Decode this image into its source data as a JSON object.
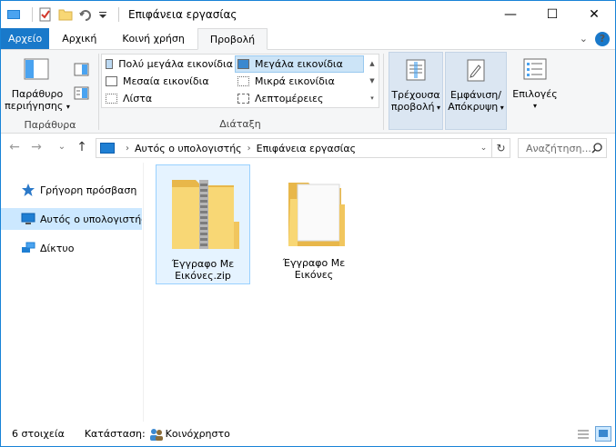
{
  "window": {
    "title": "Επιφάνεια εργασίας",
    "controls": {
      "minimize": "—",
      "maximize": "☐",
      "close": "✕"
    }
  },
  "ribbon_tabs": [
    "Αρχείο",
    "Αρχική",
    "Κοινή χρήση",
    "Προβολή"
  ],
  "ribbon_tabs_active": "Προβολή",
  "ribbon": {
    "panes": {
      "nav_pane_label_1": "Παράθυρο",
      "nav_pane_label_2": "περιήγησης",
      "group_label": "Παράθυρα"
    },
    "layout": {
      "items": [
        "Πολύ μεγάλα εικονίδια",
        "Μεγάλα εικονίδια",
        "Μεσαία εικονίδια",
        "Μικρά εικονίδια",
        "Λίστα",
        "Λεπτομέρειες"
      ],
      "selected": "Μεγάλα εικονίδια",
      "group_label": "Διάταξη"
    },
    "current_view": {
      "line1": "Τρέχουσα",
      "line2": "προβολή"
    },
    "show_hide": {
      "line1": "Εμφάνιση/",
      "line2": "Απόκρυψη"
    },
    "options": {
      "label": "Επιλογές"
    }
  },
  "address": {
    "crumbs": [
      "Αυτός ο υπολογιστής",
      "Επιφάνεια εργασίας"
    ],
    "search_placeholder": "Αναζήτηση..."
  },
  "nav_pane": {
    "items": [
      {
        "label": "Γρήγορη πρόσβαση",
        "icon": "star-icon",
        "selected": false
      },
      {
        "label": "Αυτός ο υπολογιστής",
        "icon": "computer-icon",
        "selected": true
      },
      {
        "label": "Δίκτυο",
        "icon": "network-icon",
        "selected": false
      }
    ]
  },
  "files": [
    {
      "name_line1": "Έγγραφο Με",
      "name_line2": "Εικόνες.zip",
      "icon": "zip-folder-icon",
      "selected": true
    },
    {
      "name_line1": "Έγγραφο Με",
      "name_line2": "Εικόνες",
      "icon": "folder-icon",
      "selected": false
    }
  ],
  "status": {
    "count": "6 στοιχεία",
    "state_label": "Κατάσταση:",
    "state_value": "Κοινόχρηστο"
  },
  "colors": {
    "accent": "#1979ca",
    "selection_bg": "#cce8ff",
    "folder_yellow": "#f8d775"
  }
}
